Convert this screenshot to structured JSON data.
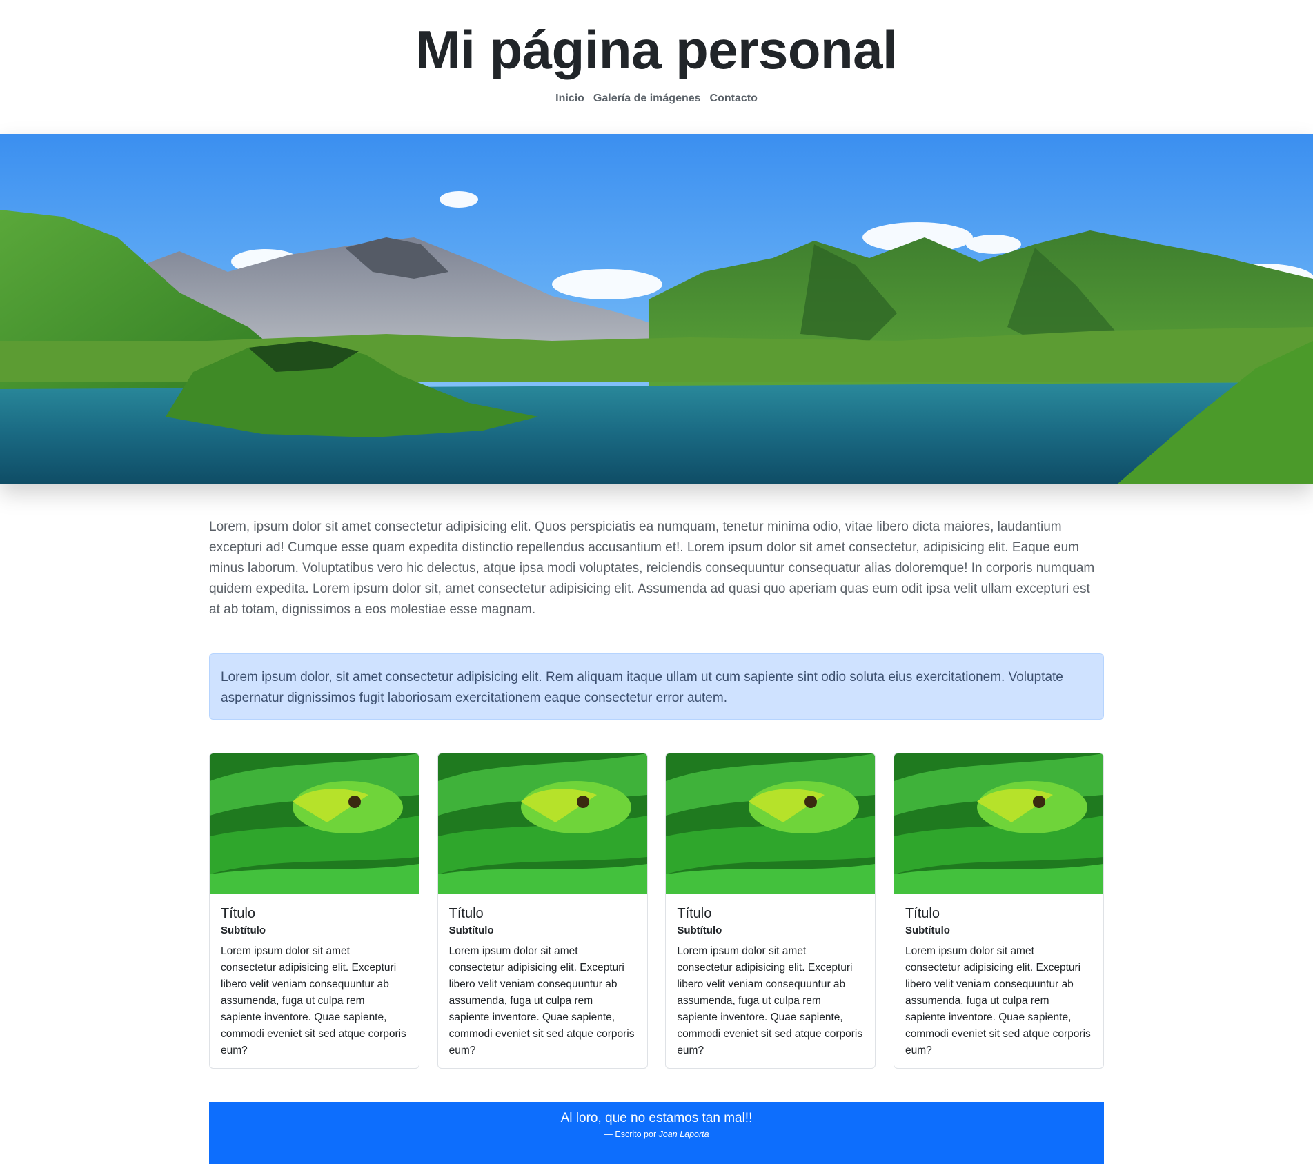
{
  "header": {
    "title": "Mi página personal",
    "nav": [
      "Inicio",
      "Galería de imágenes",
      "Contacto"
    ]
  },
  "intro": "Lorem, ipsum dolor sit amet consectetur adipisicing elit. Quos perspiciatis ea numquam, tenetur minima odio, vitae libero dicta maiores, laudantium excepturi ad! Cumque esse quam expedita distinctio repellendus accusantium et!. Lorem ipsum dolor sit amet consectetur, adipisicing elit. Eaque eum minus laborum. Voluptatibus vero hic delectus, atque ipsa modi voluptates, reiciendis consequuntur consequatur alias doloremque! In corporis numquam quidem expedita. Lorem ipsum dolor sit, amet consectetur adipisicing elit. Assumenda ad quasi quo aperiam quas eum odit ipsa velit ullam excepturi est at ab totam, dignissimos a eos molestiae esse magnam.",
  "alert": "Lorem ipsum dolor, sit amet consectetur adipisicing elit. Rem aliquam itaque ullam ut cum sapiente sint odio soluta eius exercitationem. Voluptate aspernatur dignissimos fugit laboriosam exercitationem eaque consectetur error autem.",
  "cards": [
    {
      "title": "Título",
      "subtitle": "Subtítulo",
      "text": "Lorem ipsum dolor sit amet consectetur adipisicing elit. Excepturi libero velit veniam consequuntur ab assumenda, fuga ut culpa rem sapiente inventore. Quae sapiente, commodi eveniet sit sed atque corporis eum?"
    },
    {
      "title": "Título",
      "subtitle": "Subtítulo",
      "text": "Lorem ipsum dolor sit amet consectetur adipisicing elit. Excepturi libero velit veniam consequuntur ab assumenda, fuga ut culpa rem sapiente inventore. Quae sapiente, commodi eveniet sit sed atque corporis eum?"
    },
    {
      "title": "Título",
      "subtitle": "Subtítulo",
      "text": "Lorem ipsum dolor sit amet consectetur adipisicing elit. Excepturi libero velit veniam consequuntur ab assumenda, fuga ut culpa rem sapiente inventore. Quae sapiente, commodi eveniet sit sed atque corporis eum?"
    },
    {
      "title": "Título",
      "subtitle": "Subtítulo",
      "text": "Lorem ipsum dolor sit amet consectetur adipisicing elit. Excepturi libero velit veniam consequuntur ab assumenda, fuga ut culpa rem sapiente inventore. Quae sapiente, commodi eveniet sit sed atque corporis eum?"
    }
  ],
  "quote": {
    "text": "Al loro, que no estamos tan mal!!",
    "footer_prefix": "— Escrito por",
    "author": "Joan Laporta"
  },
  "colors": {
    "alert_bg": "#cfe2ff",
    "quote_bg": "#0d6efd",
    "nav_text": "#5c636a"
  }
}
